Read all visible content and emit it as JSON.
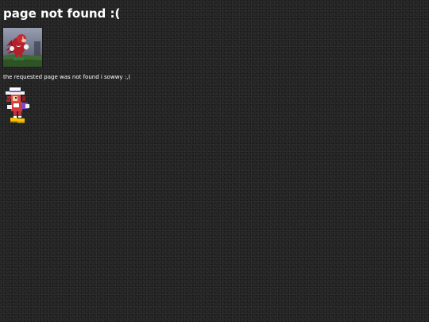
{
  "page": {
    "title": "page not found :(",
    "message": "the requested page was not found i sowwy :,(",
    "background_color": "#222222"
  },
  "images": {
    "photo": "knuckles-photo",
    "sprite": "knuckles-sprite"
  }
}
